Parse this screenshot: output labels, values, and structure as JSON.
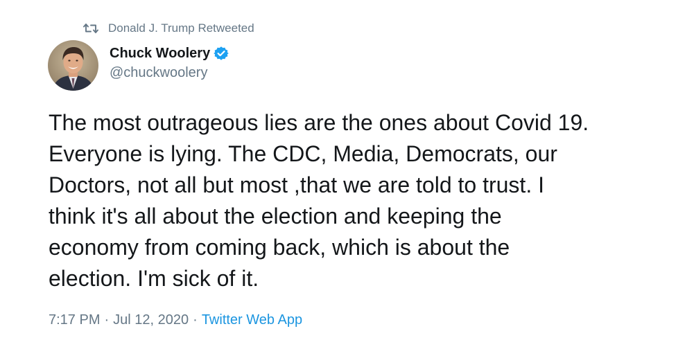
{
  "retweet": {
    "text": "Donald J. Trump Retweeted",
    "icon": "retweet-icon"
  },
  "author": {
    "display_name": "Chuck Woolery",
    "handle": "@chuckwoolery",
    "verified": true,
    "verified_color": "#1da1f2"
  },
  "tweet": {
    "text": "The most outrageous lies are the ones about Covid 19.\nEveryone is lying. The CDC, Media, Democrats, our\nDoctors, not all but most ,that we are told to trust. I\nthink it's all about the election and keeping the\neconomy from coming back, which is about the\nelection. I'm sick of it."
  },
  "meta": {
    "time": "7:17 PM",
    "separator": "·",
    "date": "Jul 12, 2020",
    "source": "Twitter Web App",
    "source_color": "#1b95e0"
  }
}
